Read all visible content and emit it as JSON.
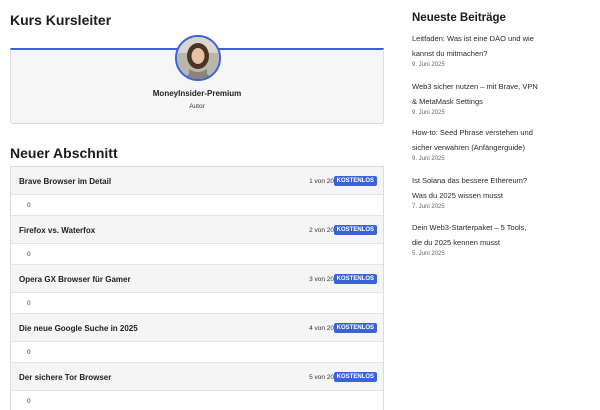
{
  "instructor": {
    "heading": "Kurs Kursleiter",
    "name": "MoneyInsider-Premium",
    "role": "Autor"
  },
  "section": {
    "heading": "Neuer Abschnitt",
    "lessons": [
      {
        "title": "Brave Browser im Detail",
        "count": "1 von 20",
        "badge": "KOSTENLOS",
        "value": "0"
      },
      {
        "title": "Firefox vs. Waterfox",
        "count": "2 von 20",
        "badge": "KOSTENLOS",
        "value": "0"
      },
      {
        "title": "Opera GX Browser für Gamer",
        "count": "3 von 20",
        "badge": "KOSTENLOS",
        "value": "0"
      },
      {
        "title": "Die neue Google Suche in 2025",
        "count": "4 von 20",
        "badge": "KOSTENLOS",
        "value": "0"
      },
      {
        "title": "Der sichere Tor Browser",
        "count": "5 von 20",
        "badge": "KOSTENLOS",
        "value": "0"
      }
    ]
  },
  "sidebar": {
    "heading": "Neueste Beiträge",
    "posts": [
      {
        "title_line1": "Leitfaden: Was ist eine DAO und wie",
        "title_line2": "kannst du mitmachen?",
        "date": "9. Juni 2025"
      },
      {
        "title_line1": "Web3 sicher nutzen – mit Brave, VPN",
        "title_line2": "& MetaMask Settings",
        "date": "9. Juni 2025"
      },
      {
        "title_line1": "How-to: Seed Phrase verstehen und",
        "title_line2": "sicher verwahren (Anfängerguide)",
        "date": "9. Juni 2025"
      },
      {
        "title_line1": "Ist Solana das bessere Ethereum?",
        "title_line2": "Was du 2025 wissen musst",
        "date": "7. Juni 2025"
      },
      {
        "title_line1": "Dein Web3-Starterpaket – 5 Tools,",
        "title_line2": "die du 2025 kennen musst",
        "date": "5. Juni 2025"
      }
    ]
  },
  "colors": {
    "accent": "#3b63d8",
    "card_bg": "#f6f6f6"
  }
}
